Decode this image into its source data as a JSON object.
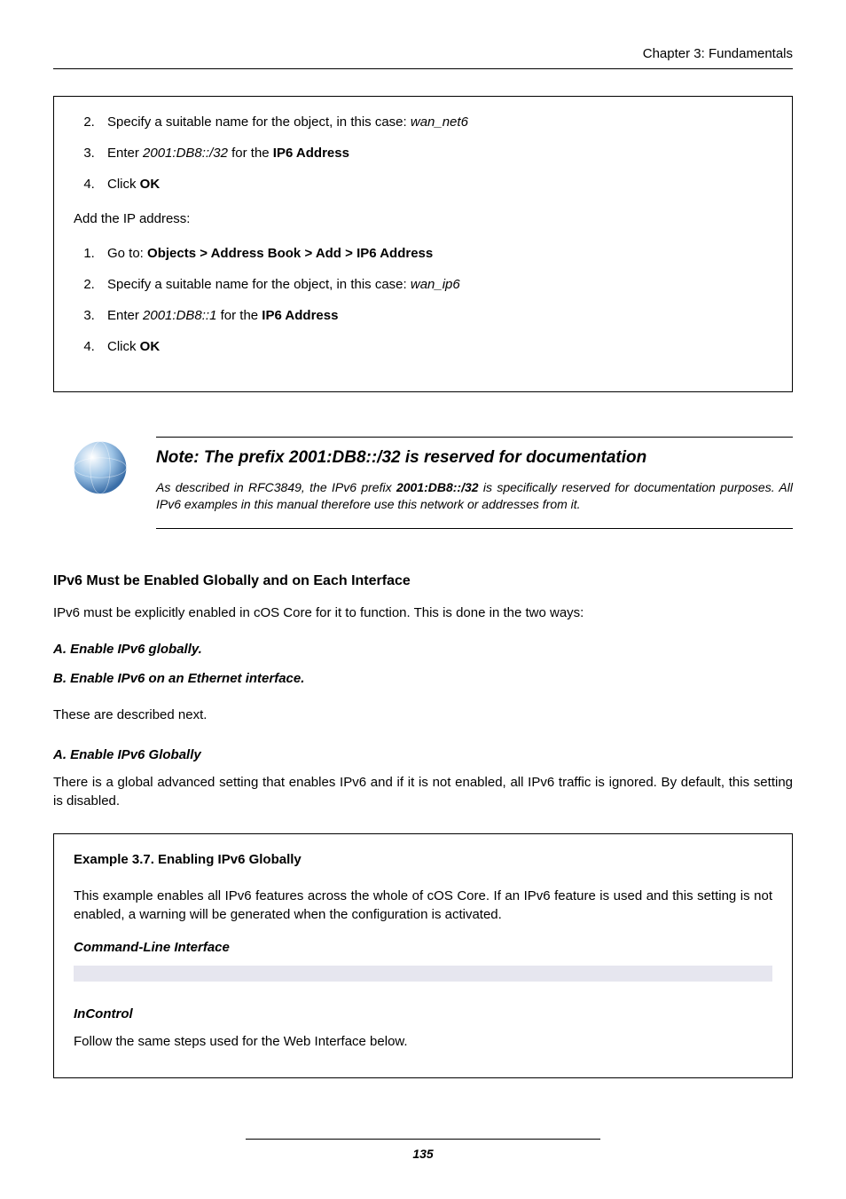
{
  "header": {
    "chapter": "Chapter 3: Fundamentals"
  },
  "box1": {
    "list1": {
      "i2": {
        "pre": "Specify a suitable name for the object, in this case: ",
        "em": "wan_net6"
      },
      "i3": {
        "pre": "Enter ",
        "em": "2001:DB8::/32",
        "mid": " for the ",
        "bold": "IP6 Address"
      },
      "i4": {
        "pre": "Click ",
        "bold": "OK"
      }
    },
    "intermission": "Add the IP address:",
    "list2": {
      "i1": {
        "pre": "Go to: ",
        "bold": "Objects > Address Book > Add > IP6 Address"
      },
      "i2": {
        "pre": "Specify a suitable name for the object, in this case: ",
        "em": "wan_ip6"
      },
      "i3": {
        "pre": "Enter ",
        "em": "2001:DB8::1",
        "mid": " for the ",
        "bold": "IP6 Address"
      },
      "i4": {
        "pre": "Click ",
        "bold": "OK"
      }
    }
  },
  "note": {
    "title": "Note: The prefix 2001:DB8::/32 is reserved for documentation",
    "body_pre": "As described in RFC3849, the IPv6 prefix ",
    "body_bold": "2001:DB8::/32",
    "body_post": " is specifically reserved for documentation purposes. All IPv6 examples in this manual therefore use this network or addresses from it."
  },
  "section": {
    "heading": "IPv6 Must be Enabled Globally and on Each Interface",
    "p1": "IPv6 must be explicitly enabled in cOS Core for it to function. This is done in the two ways:",
    "optA": "A. Enable IPv6 globally.",
    "optB": "B. Enable IPv6 on an Ethernet interface.",
    "p2": "These are described next.",
    "subA_title": "A. Enable IPv6 Globally",
    "subA_body": "There is a global advanced setting that enables IPv6 and if it is not enabled, all IPv6 traffic is ignored. By default, this setting is disabled."
  },
  "example": {
    "title": "Example 3.7. Enabling IPv6 Globally",
    "body": "This example enables all IPv6 features across the whole of cOS Core. If an IPv6 feature is used and this setting is not enabled, a warning will be generated when the configuration is activated.",
    "cli": "Command-Line Interface",
    "incontrol": "InControl",
    "incontrol_body": "Follow the same steps used for the Web Interface below."
  },
  "footer": {
    "page": "135"
  }
}
